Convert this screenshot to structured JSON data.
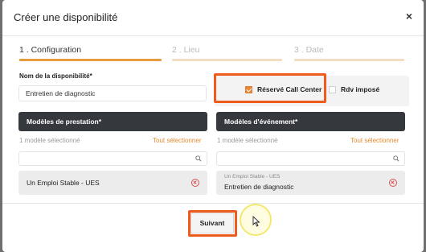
{
  "modal": {
    "title": "Créer une disponibilité",
    "close_label": "×"
  },
  "steps": [
    {
      "label": "1 . Configuration",
      "active": true
    },
    {
      "label": "2 . Lieu",
      "active": false
    },
    {
      "label": "3 . Date",
      "active": false
    }
  ],
  "availability_name": {
    "label": "Nom de la disponibilité*",
    "value": "Entretien de diagnostic"
  },
  "options": {
    "call_center": {
      "label": "Réservé Call Center",
      "checked": true
    },
    "rdv_impose": {
      "label": "Rdv imposé",
      "checked": false
    }
  },
  "prestation_models": {
    "header": "Modèles de prestation*",
    "count_text": "1 modèle sélectionné",
    "select_all": "Tout sélectionner",
    "search_placeholder": "",
    "items": [
      {
        "label": "Un Emploi Stable - UES"
      }
    ]
  },
  "event_models": {
    "header": "Modèles d'événement*",
    "count_text": "1 modèle sélectionné",
    "select_all": "Tout sélectionner",
    "search_placeholder": "",
    "items": [
      {
        "subtitle": "Un Emploi Stable - UES",
        "label": "Entretien de diagnostic"
      }
    ]
  },
  "footer": {
    "next_label": "Suivant"
  },
  "colors": {
    "accent": "#e79b3c",
    "highlight": "#ef5a1d",
    "dark_header": "#35393d",
    "remove": "#d9534f"
  },
  "icons": {
    "search": "search-icon",
    "remove": "remove-icon",
    "close": "close-icon",
    "check": "check-icon",
    "cursor": "cursor-icon"
  }
}
